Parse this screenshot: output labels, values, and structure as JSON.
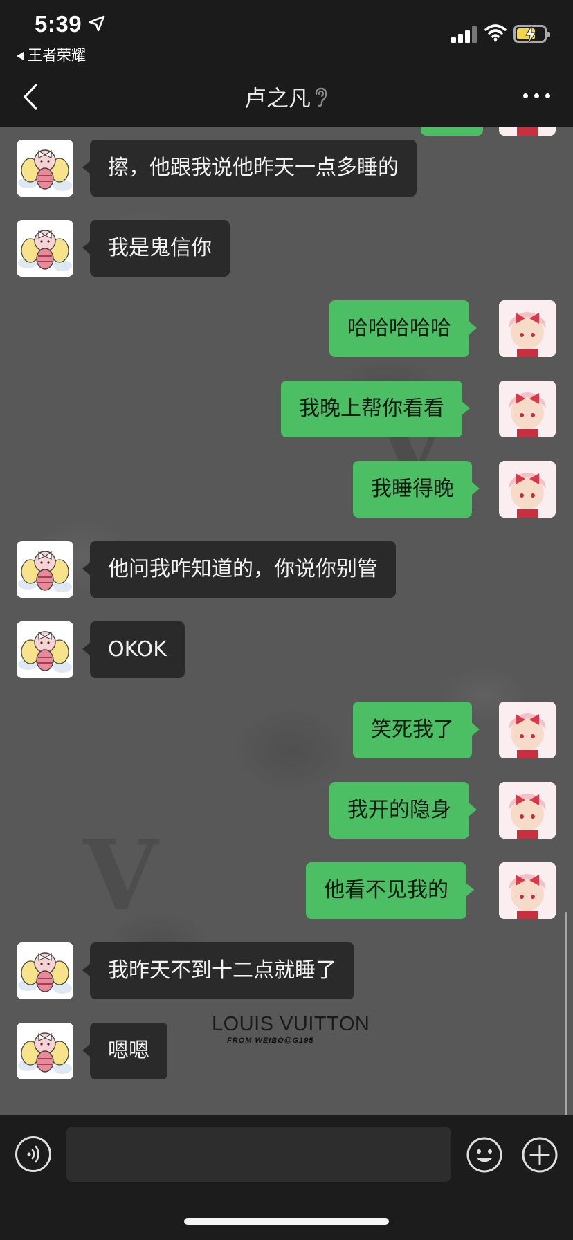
{
  "status_bar": {
    "time": "5:39",
    "back_app": "王者荣耀"
  },
  "nav": {
    "title": "卢之凡"
  },
  "messages": [
    {
      "side": "left",
      "text": "擦，他跟我说他昨天一点多睡的"
    },
    {
      "side": "left",
      "text": "我是鬼信你"
    },
    {
      "side": "right",
      "text": "哈哈哈哈哈"
    },
    {
      "side": "right",
      "text": "我晚上帮你看看"
    },
    {
      "side": "right",
      "text": "我睡得晚"
    },
    {
      "side": "left",
      "text": "他问我咋知道的，你说你别管"
    },
    {
      "side": "left",
      "text": "OKOK"
    },
    {
      "side": "right",
      "text": "笑死我了"
    },
    {
      "side": "right",
      "text": "我开的隐身"
    },
    {
      "side": "right",
      "text": "他看不见我的"
    },
    {
      "side": "left",
      "text": "我昨天不到十二点就睡了"
    },
    {
      "side": "left",
      "text": "嗯嗯"
    }
  ],
  "wallpaper": {
    "brand": "LOUIS VUITTON",
    "credit": "FROM WEIBO@G195"
  },
  "input": {
    "value": ""
  },
  "colors": {
    "sent_bubble": "#4cbf65",
    "received_bubble": "#2a2a2a",
    "bar_background": "#1b1b1b",
    "battery_fill": "#f2d74a"
  },
  "icons": {
    "nav_back": "chevron-left-icon",
    "title_badge": "ear-icon",
    "more": "more-dots-icon",
    "voice": "voice-icon",
    "emoji": "emoji-icon",
    "plus": "plus-icon"
  }
}
